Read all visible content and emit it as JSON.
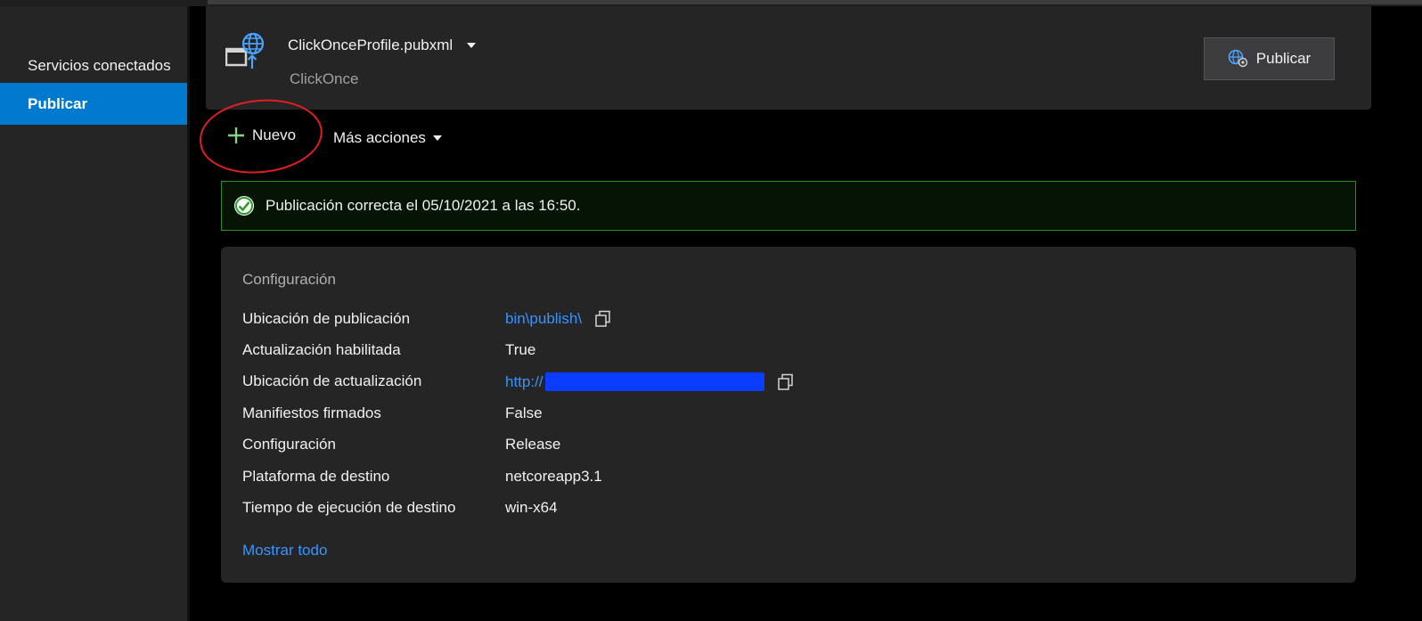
{
  "sidebar": {
    "items": [
      {
        "label": "Servicios conectados"
      },
      {
        "label": "Publicar"
      }
    ]
  },
  "profile": {
    "name": "ClickOnceProfile.pubxml",
    "type": "ClickOnce",
    "publish_label": "Publicar"
  },
  "actions": {
    "new_label": "Nuevo",
    "more_label": "Más acciones"
  },
  "banner": {
    "message": "Publicación correcta el 05/10/2021 a las 16:50."
  },
  "config": {
    "title": "Configuración",
    "rows": [
      {
        "label": "Ubicación de publicación",
        "value": "bin\\publish\\"
      },
      {
        "label": "Actualización habilitada",
        "value": "True"
      },
      {
        "label": "Ubicación de actualización",
        "value": "http://"
      },
      {
        "label": "Manifiestos firmados",
        "value": "False"
      },
      {
        "label": "Configuración",
        "value": "Release"
      },
      {
        "label": "Plataforma de destino",
        "value": "netcoreapp3.1"
      },
      {
        "label": "Tiempo de ejecución de destino",
        "value": "win-x64"
      }
    ],
    "show_all": "Mostrar todo"
  },
  "colors": {
    "accent": "#007acc",
    "link": "#3794ff",
    "success": "#2e8b2e",
    "annotation": "#e02020"
  },
  "icons": [
    "publish-profile-icon",
    "publish-globe-icon",
    "plus-icon",
    "chevron-down-icon",
    "success-check-icon",
    "copy-icon"
  ]
}
